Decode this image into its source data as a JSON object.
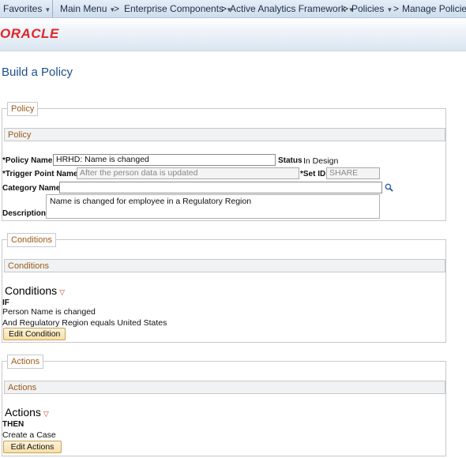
{
  "nav": {
    "favorites": "Favorites",
    "breadcrumbs": [
      "Main Menu",
      "Enterprise Components",
      "Active Analytics Framework",
      "Policies",
      "Manage Policies"
    ],
    "sep": ">"
  },
  "brand": {
    "logo": "ORACLE",
    "logo_color": "#e0262b"
  },
  "page": {
    "title": "Build a Policy"
  },
  "policy": {
    "legend": "Policy",
    "subheader": "Policy",
    "policy_name_label": "*Policy Name",
    "policy_name_value": "HRHD: Name is changed",
    "status_label": "Status",
    "status_value": "In Design",
    "trigger_label": "*Trigger Point Name",
    "trigger_value": "After the person data is updated",
    "setid_label": "*Set ID",
    "setid_value": "SHARE",
    "category_label": "Category Name",
    "category_value": "",
    "description_label": "Description",
    "description_value": "Name is changed for employee in a Regulatory Region"
  },
  "conditions": {
    "legend": "Conditions",
    "subheader": "Conditions",
    "header": "Conditions",
    "keyword": "IF",
    "lines": [
      "Person Name is changed",
      "And Regulatory Region equals United States"
    ],
    "button": "Edit Condition"
  },
  "actions": {
    "legend": "Actions",
    "subheader": "Actions",
    "header": "Actions",
    "keyword": "THEN",
    "lines": [
      "Create a Case"
    ],
    "button": "Edit Actions"
  }
}
